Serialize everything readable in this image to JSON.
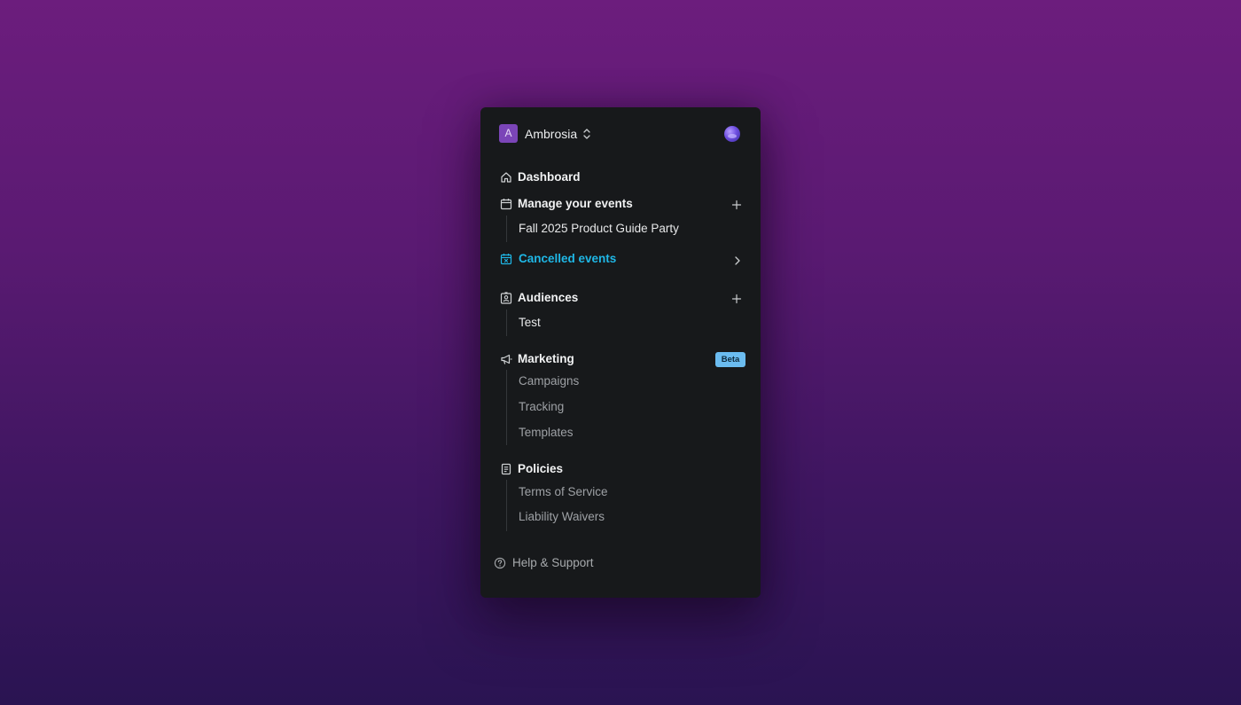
{
  "workspace": {
    "initial": "A",
    "name": "Ambrosia"
  },
  "nav": {
    "dashboard": {
      "label": "Dashboard",
      "icon": "home-icon"
    },
    "events": {
      "label": "Manage your events",
      "icon": "calendar-icon",
      "items": [
        "Fall 2025 Product Guide Party"
      ]
    },
    "cancelled": {
      "label": "Cancelled events",
      "icon": "calendar-x-icon"
    },
    "audiences": {
      "label": "Audiences",
      "icon": "contact-card-icon",
      "items": [
        "Test"
      ]
    },
    "marketing": {
      "label": "Marketing",
      "icon": "megaphone-icon",
      "badge": "Beta",
      "items": [
        "Campaigns",
        "Tracking",
        "Templates"
      ]
    },
    "policies": {
      "label": "Policies",
      "icon": "document-icon",
      "items": [
        "Terms of Service",
        "Liability Waivers"
      ]
    }
  },
  "footer": {
    "help_label": "Help & Support"
  },
  "colors": {
    "accent": "#1fb7e6",
    "badge": "#6bbcf0",
    "workspace_avatar": "#7b45b8",
    "panel_bg": "#17191b"
  }
}
